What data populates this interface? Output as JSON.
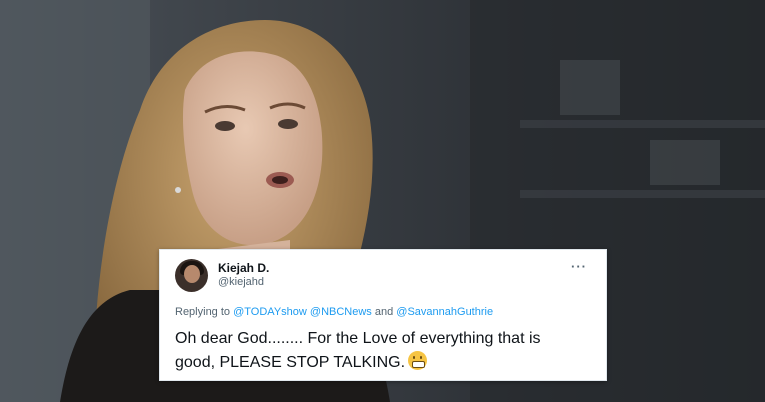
{
  "tweet": {
    "display_name": "Kiejah D.",
    "handle": "@kiejahd",
    "replying_label": "Replying to",
    "mentions": [
      "@TODAYshow",
      "@NBCNews",
      "@SavannahGuthrie"
    ],
    "mention_joiner": "and",
    "text_line1": "Oh dear God........ For the Love of everything that is",
    "text_line2": "good, PLEASE STOP TALKING.",
    "emoji": "grimacing-face-emoji",
    "more_label": "···"
  },
  "colors": {
    "mention_blue": "#1d9bf0",
    "text": "#0f1419",
    "secondary": "#536471"
  }
}
